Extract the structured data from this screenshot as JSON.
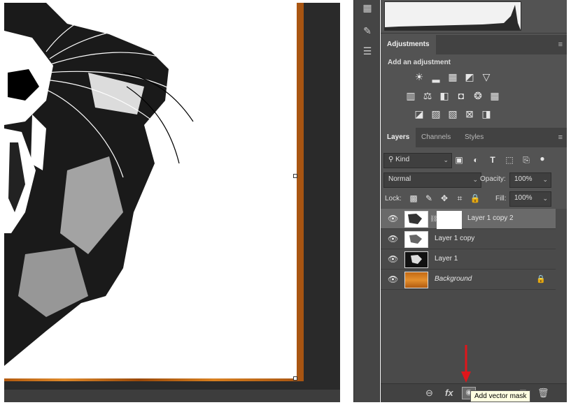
{
  "adjustments_panel": {
    "tab": "Adjustments",
    "heading": "Add an adjustment",
    "icons_row1": [
      "brightness-contrast-icon",
      "levels-icon",
      "curves-icon",
      "exposure-icon",
      "vibrance-icon"
    ],
    "icons_row2": [
      "hue-saturation-icon",
      "color-balance-icon",
      "black-white-icon",
      "photo-filter-icon",
      "channel-mixer-icon",
      "color-lookup-icon"
    ],
    "icons_row3": [
      "invert-icon",
      "posterize-icon",
      "threshold-icon",
      "selective-color-icon",
      "gradient-map-icon"
    ]
  },
  "layers_panel": {
    "tabs": [
      "Layers",
      "Channels",
      "Styles"
    ],
    "active_tab": "Layers",
    "filter_kind": "Kind",
    "blend_mode": "Normal",
    "opacity_label": "Opacity:",
    "opacity_value": "100%",
    "lock_label": "Lock:",
    "fill_label": "Fill:",
    "fill_value": "100%",
    "layers": [
      {
        "name": "Layer 1 copy 2",
        "selected": true,
        "has_mask": true
      },
      {
        "name": "Layer 1 copy",
        "selected": false
      },
      {
        "name": "Layer 1",
        "selected": false
      },
      {
        "name": "Background",
        "selected": false,
        "locked": true,
        "italic": true
      }
    ]
  },
  "tooltip": "Add vector mask",
  "colors": {
    "panel_bg": "#535353",
    "tab_bar": "#424242",
    "selected_row": "#6a6a6a",
    "arrow": "#e0161b",
    "wood": "#d9801f"
  }
}
